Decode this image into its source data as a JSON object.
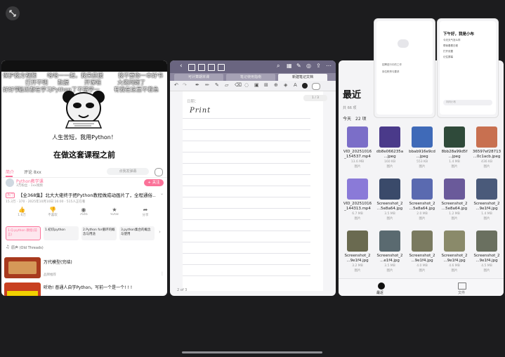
{
  "w1": {
    "danmu": [
      "保护我方视频",
      "哈哈一一起，我来应援",
      "我不要你",
      "一本好书",
      "打开不明",
      "数据",
      "开课啦",
      "大佬问题了",
      "好好学",
      "跟上节奏",
      "最近都在学习Python了不错学一",
      "我想好了",
      "有我在这里不着急"
    ],
    "video_text1": "人生苦短，我用Python！",
    "video_text2": "在做这套课程之前",
    "tabs": [
      "简介",
      "评论 8xx"
    ],
    "danmu_input": "点我发弹幕",
    "uploader": "Python教学课",
    "uploader_sub": "3万粉丝 · 1xx视频",
    "follow": "+ 关注",
    "hot_badge": "热门",
    "video_title": "【全368集】北大大佬终于把Python教程做成动画片了，全程通俗...",
    "stats": "15.3万 · 370 · 2025年10月10日 16:00 · 515人正在看",
    "actions": [
      "1.6万",
      "不喜欢",
      "7646",
      "9268",
      "分享"
    ],
    "episodes": [
      "1.Q.python 教程(前言)",
      "1.初识python",
      "2.Python for循环的概念与用途",
      "3.python集合的概念与使用"
    ],
    "bgm": "原声 (Old Threads)",
    "rec1_title": "万代模型(完结)",
    "rec1_meta": "",
    "rec1_sub": "品牌推荐",
    "rec2_title": "听劝! 普通人自学Python，写前一个是一个! ! !"
  },
  "w2": {
    "tabs": [
      "可计算期末课",
      "笔记使用指南",
      "新建笔记文档"
    ],
    "date_label": "日期：",
    "handwriting": "Print",
    "page_counter": "1 / 3",
    "page_footer": "2 of 3"
  },
  "w3": {
    "title": "最近",
    "subtitle": "共 66 项",
    "today_label": "今天",
    "today_count": "22 项",
    "files": [
      {
        "name": "VID_20251016 _154537.mp4",
        "size": "13.6 MB",
        "type": "图片",
        "color": "#7b6ec8"
      },
      {
        "name": "db8e066235a ...jpeg",
        "size": "160 KB",
        "type": "图片",
        "color": "#4a3a8a"
      },
      {
        "name": "bbab916e9cd ...jpeg",
        "size": "553 KB",
        "type": "图片",
        "color": "#3f6ab8"
      },
      {
        "name": "8bb28a99d5f ...jpeg",
        "size": "1.4 MB",
        "type": "图片",
        "color": "#2f4a3a"
      },
      {
        "name": "36597ef28713 ...0c1acb.jpeg",
        "size": "436 KB",
        "type": "图片",
        "color": "#c87050"
      },
      {
        "name": "VID_20251016 _144313.mp4",
        "size": "6.7 MB",
        "type": "图片",
        "color": "#8a7ad8"
      },
      {
        "name": "Screenshot_2 ...5e8a64.jpg",
        "size": "3.5 MB",
        "type": "图片",
        "color": "#3a4a6a"
      },
      {
        "name": "Screenshot_2 ...5e8a64.jpg",
        "size": "2.0 MB",
        "type": "图片",
        "color": "#5a6ab0"
      },
      {
        "name": "Screenshot_2 ...5e8a64.jpg",
        "size": "1.2 MB",
        "type": "图片",
        "color": "#6a5a9a"
      },
      {
        "name": "Screenshot_2 ...9e1f4.jpg",
        "size": "1.4 MB",
        "type": "图片",
        "color": "#4a5a7a"
      },
      {
        "name": "Screenshot_2 ...9e1f4.jpg",
        "size": "3.2 MB",
        "type": "图片",
        "color": "#6a6a50"
      },
      {
        "name": "Screenshot_2 ...e1f4.jpg",
        "size": "3.5 MB",
        "type": "图片",
        "color": "#5a6a70"
      },
      {
        "name": "Screenshot_2 ...9e1f4.jpg",
        "size": "4.0 MB",
        "type": "图片",
        "color": "#7a7a60"
      },
      {
        "name": "Screenshot_2 ...9e1f4.jpg",
        "size": "4.6 MB",
        "type": "图片",
        "color": "#8a8a6a"
      },
      {
        "name": "Screenshot_2 ...9e1f4.jpg",
        "size": "4.5 MB",
        "type": "图片",
        "color": "#6a7060"
      }
    ],
    "nav": [
      "最近",
      "文件"
    ]
  },
  "mini": {
    "greeting": "下午好，我是小布",
    "lines": [
      "今天天气怎么样",
      "帮我看看日程",
      "打开设置",
      "记住屏幕"
    ],
    "input_hint": "问问小布",
    "card1_lines": [
      "招聘进行中的工作",
      "岗位职责与要求"
    ]
  }
}
